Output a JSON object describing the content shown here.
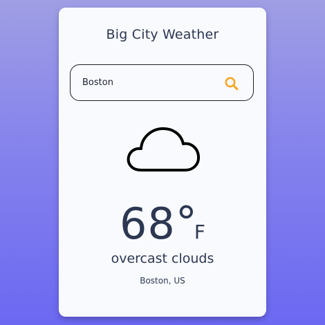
{
  "app": {
    "title": "Big City Weather"
  },
  "search": {
    "value": "Boston",
    "placeholder": "",
    "icon": "search-icon"
  },
  "weather": {
    "icon": "cloud-icon",
    "temperature": "68",
    "degree_symbol": "°",
    "unit": "F",
    "description": "overcast clouds",
    "location": "Boston, US"
  },
  "colors": {
    "accent": "#f5a623",
    "text": "#2c3752",
    "card_background": "#f8fafd",
    "page_gradient_top": "#9f9ee4",
    "page_gradient_bottom": "#6c68f2"
  }
}
